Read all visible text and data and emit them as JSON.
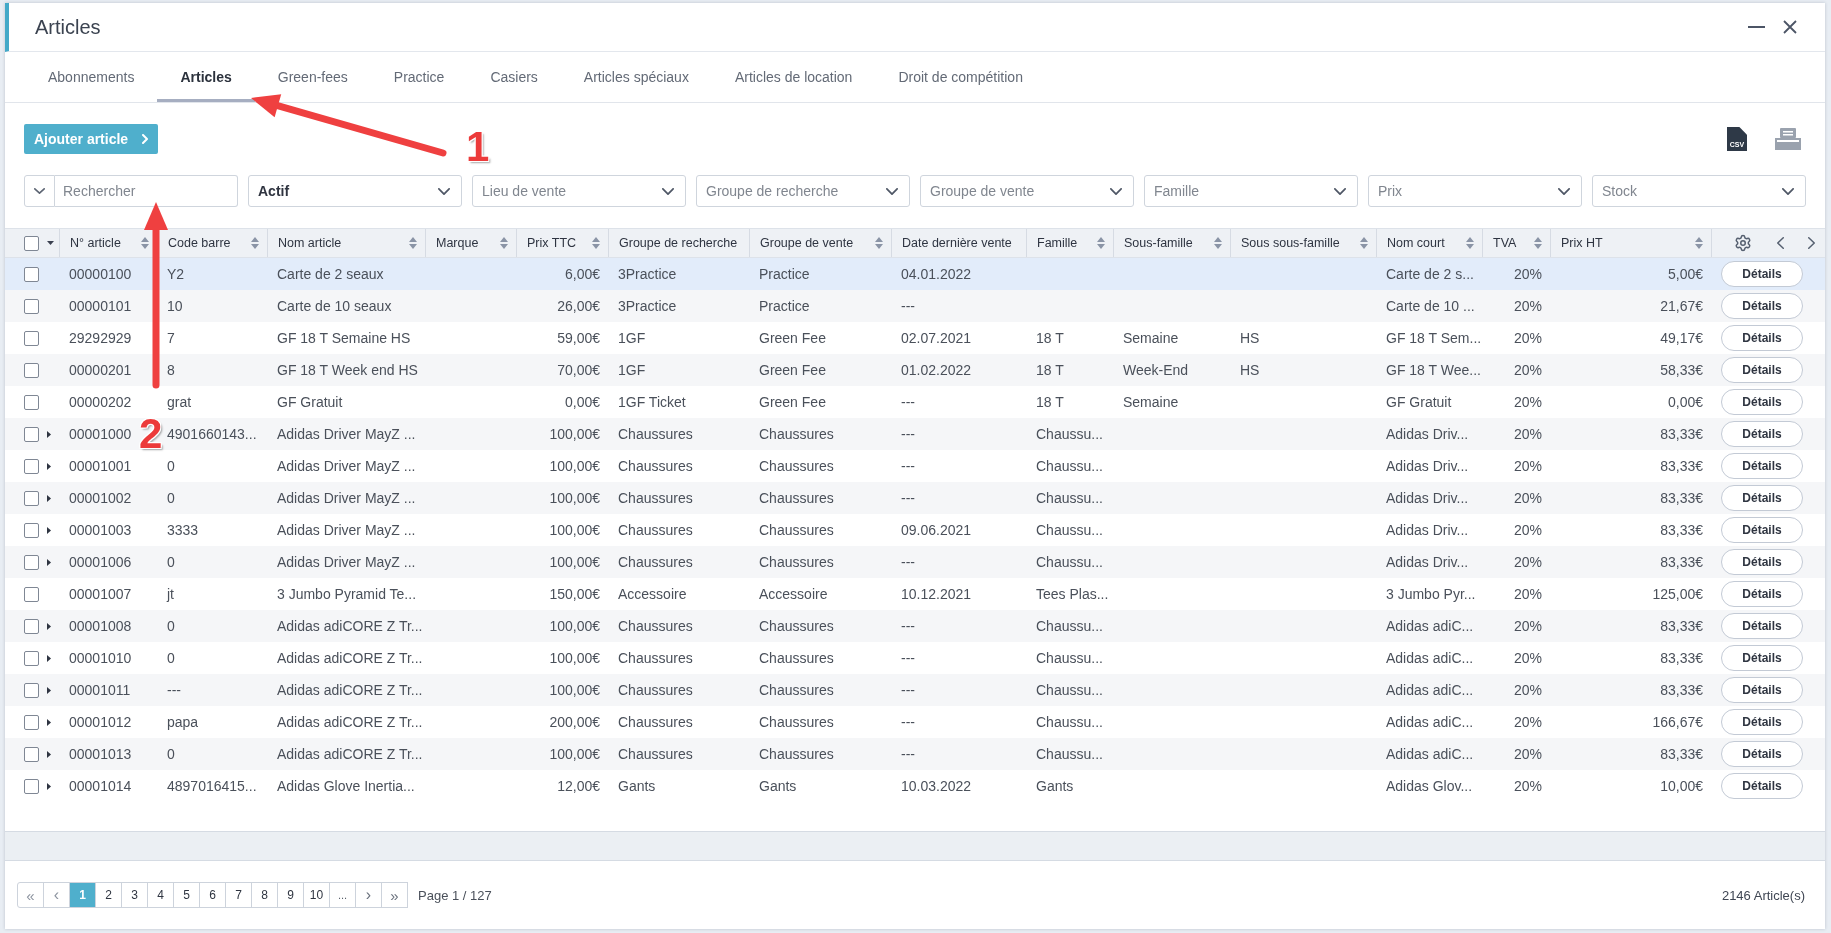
{
  "window": {
    "title": "Articles"
  },
  "tabs": [
    {
      "label": "Abonnements",
      "selected": false
    },
    {
      "label": "Articles",
      "selected": true
    },
    {
      "label": "Green-fees",
      "selected": false
    },
    {
      "label": "Practice",
      "selected": false
    },
    {
      "label": "Casiers",
      "selected": false
    },
    {
      "label": "Articles spéciaux",
      "selected": false
    },
    {
      "label": "Articles de location",
      "selected": false
    },
    {
      "label": "Droit de compétition",
      "selected": false
    }
  ],
  "toolbar": {
    "add_button": "Ajouter article",
    "csv_button": "CSV"
  },
  "filters": [
    {
      "kind": "search",
      "placeholder": "Rechercher"
    },
    {
      "kind": "select",
      "value": "Actif"
    },
    {
      "kind": "select",
      "placeholder": "Lieu de vente"
    },
    {
      "kind": "select",
      "placeholder": "Groupe de recherche"
    },
    {
      "kind": "select",
      "placeholder": "Groupe de vente"
    },
    {
      "kind": "select",
      "placeholder": "Famille"
    },
    {
      "kind": "select",
      "placeholder": "Prix"
    },
    {
      "kind": "select",
      "placeholder": "Stock"
    }
  ],
  "table": {
    "select_all": {
      "checked": false
    },
    "columns": [
      {
        "label": "N° article",
        "sortable": true,
        "kind": "text"
      },
      {
        "label": "Code barre",
        "sortable": true,
        "kind": "text"
      },
      {
        "label": "Nom article",
        "sortable": true,
        "kind": "text"
      },
      {
        "label": "Marque",
        "sortable": true,
        "kind": "text"
      },
      {
        "label": "Prix TTC",
        "sortable": true,
        "kind": "amount"
      },
      {
        "label": "Groupe de recherche",
        "sortable": false,
        "kind": "text"
      },
      {
        "label": "Groupe de vente",
        "sortable": true,
        "kind": "text"
      },
      {
        "label": "Date dernière vente",
        "sortable": false,
        "kind": "text"
      },
      {
        "label": "Famille",
        "sortable": true,
        "kind": "text"
      },
      {
        "label": "Sous-famille",
        "sortable": true,
        "kind": "text"
      },
      {
        "label": "Sous sous-famille",
        "sortable": true,
        "kind": "text"
      },
      {
        "label": "Nom court",
        "sortable": true,
        "kind": "text"
      },
      {
        "label": "TVA",
        "sortable": true,
        "kind": "percent"
      },
      {
        "label": "Prix HT",
        "sortable": true,
        "kind": "amount"
      }
    ],
    "rows": [
      {
        "checked": false,
        "highlighted": true,
        "expandable": false,
        "article_no": "00000100",
        "barcode": "Y2",
        "name": "Carte de 2 seaux",
        "price_ttc": "6,00€",
        "search_group": "3Practice",
        "sales_group": "Practice",
        "last_sale": "04.01.2022",
        "short_name": "Carte de 2 s...",
        "vat": "20%",
        "price_ht": "5,00€",
        "action": "Détails"
      },
      {
        "checked": false,
        "highlighted": false,
        "expandable": false,
        "article_no": "00000101",
        "barcode": "10",
        "name": "Carte de 10 seaux",
        "price_ttc": "26,00€",
        "search_group": "3Practice",
        "sales_group": "Practice",
        "last_sale": "---",
        "short_name": "Carte de 10 ...",
        "vat": "20%",
        "price_ht": "21,67€",
        "action": "Détails"
      },
      {
        "checked": false,
        "highlighted": false,
        "expandable": false,
        "article_no": "29292929",
        "barcode": "7",
        "name": "GF 18 T Semaine HS",
        "price_ttc": "59,00€",
        "search_group": "1GF",
        "sales_group": "Green Fee",
        "last_sale": "02.07.2021",
        "family": "18 T",
        "subfamily": "Semaine",
        "subsubfamily": "HS",
        "short_name": "GF 18 T Sem...",
        "vat": "20%",
        "price_ht": "49,17€",
        "action": "Détails"
      },
      {
        "checked": false,
        "highlighted": false,
        "expandable": false,
        "article_no": "00000201",
        "barcode": "8",
        "name": "GF 18 T Week end HS",
        "price_ttc": "70,00€",
        "search_group": "1GF",
        "sales_group": "Green Fee",
        "last_sale": "01.02.2022",
        "family": "18 T",
        "subfamily": "Week-End",
        "subsubfamily": "HS",
        "short_name": "GF 18 T Wee...",
        "vat": "20%",
        "price_ht": "58,33€",
        "action": "Détails"
      },
      {
        "checked": false,
        "highlighted": false,
        "expandable": false,
        "article_no": "00000202",
        "barcode": "grat",
        "name": "GF Gratuit",
        "price_ttc": "0,00€",
        "search_group": "1GF Ticket",
        "sales_group": "Green Fee",
        "last_sale": "---",
        "family": "18 T",
        "subfamily": "Semaine",
        "short_name": "GF Gratuit",
        "vat": "20%",
        "price_ht": "0,00€",
        "action": "Détails"
      },
      {
        "checked": false,
        "highlighted": false,
        "expandable": true,
        "article_no": "00001000",
        "barcode": "4901660143...",
        "name": "Adidas Driver MayZ ...",
        "price_ttc": "100,00€",
        "search_group": "Chaussures",
        "sales_group": "Chaussures",
        "last_sale": "---",
        "family": "Chaussu...",
        "short_name": "Adidas Driv...",
        "vat": "20%",
        "price_ht": "83,33€",
        "action": "Détails"
      },
      {
        "checked": false,
        "highlighted": false,
        "expandable": true,
        "article_no": "00001001",
        "barcode": "0",
        "name": "Adidas Driver MayZ ...",
        "price_ttc": "100,00€",
        "search_group": "Chaussures",
        "sales_group": "Chaussures",
        "last_sale": "---",
        "family": "Chaussu...",
        "short_name": "Adidas Driv...",
        "vat": "20%",
        "price_ht": "83,33€",
        "action": "Détails"
      },
      {
        "checked": false,
        "highlighted": false,
        "expandable": true,
        "article_no": "00001002",
        "barcode": "0",
        "name": "Adidas Driver MayZ ...",
        "price_ttc": "100,00€",
        "search_group": "Chaussures",
        "sales_group": "Chaussures",
        "last_sale": "---",
        "family": "Chaussu...",
        "short_name": "Adidas Driv...",
        "vat": "20%",
        "price_ht": "83,33€",
        "action": "Détails"
      },
      {
        "checked": false,
        "highlighted": false,
        "expandable": true,
        "article_no": "00001003",
        "barcode": "3333",
        "name": "Adidas Driver MayZ ...",
        "price_ttc": "100,00€",
        "search_group": "Chaussures",
        "sales_group": "Chaussures",
        "last_sale": "09.06.2021",
        "family": "Chaussu...",
        "short_name": "Adidas Driv...",
        "vat": "20%",
        "price_ht": "83,33€",
        "action": "Détails"
      },
      {
        "checked": false,
        "highlighted": false,
        "expandable": true,
        "article_no": "00001006",
        "barcode": "0",
        "name": "Adidas Driver MayZ ...",
        "price_ttc": "100,00€",
        "search_group": "Chaussures",
        "sales_group": "Chaussures",
        "last_sale": "---",
        "family": "Chaussu...",
        "short_name": "Adidas Driv...",
        "vat": "20%",
        "price_ht": "83,33€",
        "action": "Détails"
      },
      {
        "checked": false,
        "highlighted": false,
        "expandable": false,
        "article_no": "00001007",
        "barcode": "jt",
        "name": "3 Jumbo Pyramid Te...",
        "price_ttc": "150,00€",
        "search_group": "Accessoire",
        "sales_group": "Accessoire",
        "last_sale": "10.12.2021",
        "family": "Tees Plas...",
        "short_name": "3 Jumbo Pyr...",
        "vat": "20%",
        "price_ht": "125,00€",
        "action": "Détails"
      },
      {
        "checked": false,
        "highlighted": false,
        "expandable": true,
        "article_no": "00001008",
        "barcode": "0",
        "name": "Adidas adiCORE Z Tr...",
        "price_ttc": "100,00€",
        "search_group": "Chaussures",
        "sales_group": "Chaussures",
        "last_sale": "---",
        "family": "Chaussu...",
        "short_name": "Adidas adiC...",
        "vat": "20%",
        "price_ht": "83,33€",
        "action": "Détails"
      },
      {
        "checked": false,
        "highlighted": false,
        "expandable": true,
        "article_no": "00001010",
        "barcode": "0",
        "name": "Adidas adiCORE Z Tr...",
        "price_ttc": "100,00€",
        "search_group": "Chaussures",
        "sales_group": "Chaussures",
        "last_sale": "---",
        "family": "Chaussu...",
        "short_name": "Adidas adiC...",
        "vat": "20%",
        "price_ht": "83,33€",
        "action": "Détails"
      },
      {
        "checked": false,
        "highlighted": false,
        "expandable": true,
        "article_no": "00001011",
        "barcode": "---",
        "name": "Adidas adiCORE Z Tr...",
        "price_ttc": "100,00€",
        "search_group": "Chaussures",
        "sales_group": "Chaussures",
        "last_sale": "---",
        "family": "Chaussu...",
        "short_name": "Adidas adiC...",
        "vat": "20%",
        "price_ht": "83,33€",
        "action": "Détails"
      },
      {
        "checked": false,
        "highlighted": false,
        "expandable": true,
        "article_no": "00001012",
        "barcode": "papa",
        "name": "Adidas adiCORE Z Tr...",
        "price_ttc": "200,00€",
        "search_group": "Chaussures",
        "sales_group": "Chaussures",
        "last_sale": "---",
        "family": "Chaussu...",
        "short_name": "Adidas adiC...",
        "vat": "20%",
        "price_ht": "166,67€",
        "action": "Détails"
      },
      {
        "checked": false,
        "highlighted": false,
        "expandable": true,
        "article_no": "00001013",
        "barcode": "0",
        "name": "Adidas adiCORE Z Tr...",
        "price_ttc": "100,00€",
        "search_group": "Chaussures",
        "sales_group": "Chaussures",
        "last_sale": "---",
        "family": "Chaussu...",
        "short_name": "Adidas adiC...",
        "vat": "20%",
        "price_ht": "83,33€",
        "action": "Détails"
      },
      {
        "checked": false,
        "highlighted": false,
        "expandable": true,
        "article_no": "00001014",
        "barcode": "4897016415...",
        "name": "Adidas Glove Inertia...",
        "price_ttc": "12,00€",
        "search_group": "Gants",
        "sales_group": "Gants",
        "last_sale": "10.03.2022",
        "family": "Gants",
        "short_name": "Adidas Glov...",
        "vat": "20%",
        "price_ht": "10,00€",
        "action": "Détails"
      }
    ]
  },
  "pagination": {
    "pages": [
      {
        "kind": "first",
        "label": "«",
        "selected": false
      },
      {
        "kind": "previous",
        "label": "‹",
        "selected": false
      },
      {
        "kind": "page",
        "label": "1",
        "selected": true
      },
      {
        "kind": "page",
        "label": "2",
        "selected": false
      },
      {
        "kind": "page",
        "label": "3",
        "selected": false
      },
      {
        "kind": "page",
        "label": "4",
        "selected": false
      },
      {
        "kind": "page",
        "label": "5",
        "selected": false
      },
      {
        "kind": "page",
        "label": "6",
        "selected": false
      },
      {
        "kind": "page",
        "label": "7",
        "selected": false
      },
      {
        "kind": "page",
        "label": "8",
        "selected": false
      },
      {
        "kind": "page",
        "label": "9",
        "selected": false
      },
      {
        "kind": "page",
        "label": "10",
        "selected": false
      },
      {
        "kind": "more",
        "label": "...",
        "selected": false
      },
      {
        "kind": "next",
        "label": "›",
        "selected": false
      },
      {
        "kind": "last",
        "label": "»",
        "selected": false
      }
    ],
    "page_info": "Page 1 / 127",
    "total": "2146 Article(s)"
  },
  "annotations": [
    {
      "label": "1"
    },
    {
      "label": "2"
    }
  ]
}
